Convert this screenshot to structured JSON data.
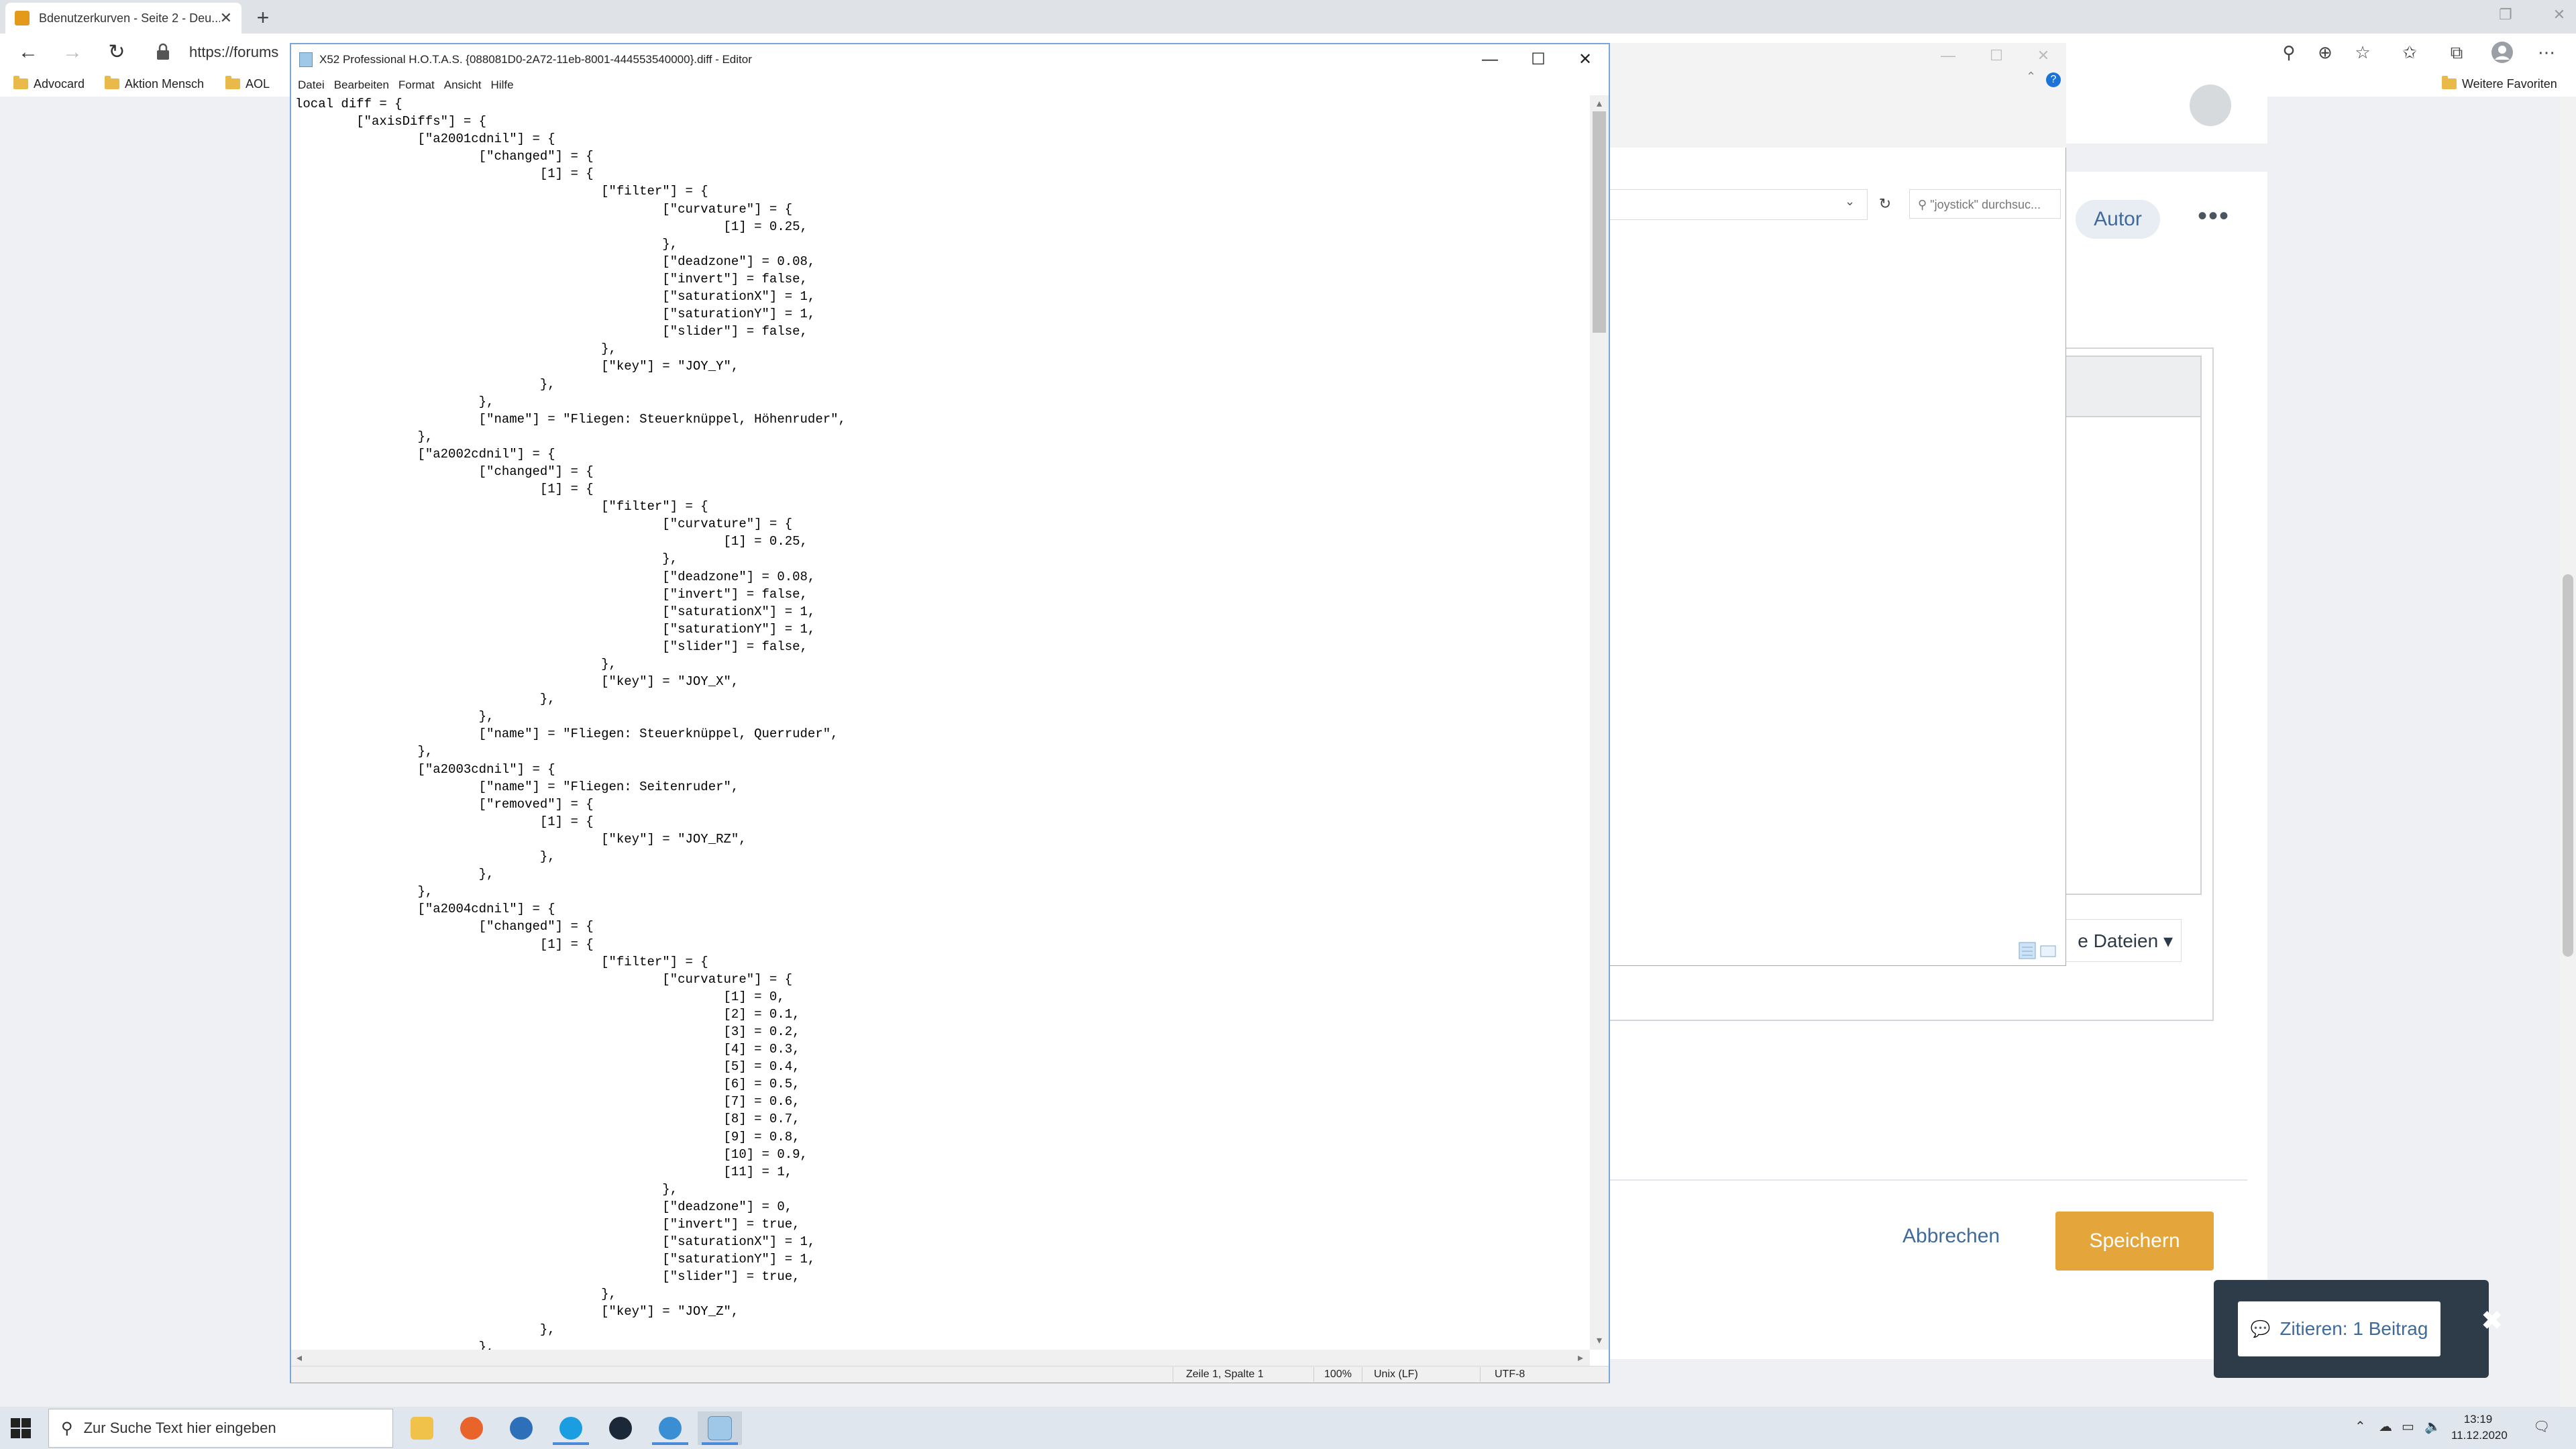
{
  "browser": {
    "tab_title": "Bdenutzerkurven - Seite 2 - Deu...",
    "tab_close": "✕",
    "new_tab": "+",
    "address": "https://forums",
    "bookmarks": [
      {
        "label": "Advocard"
      },
      {
        "label": "Aktion Mensch"
      },
      {
        "label": "AOL"
      }
    ],
    "bookmarks_right": "Weitere Favoriten"
  },
  "webpage": {
    "autor_label": "Autor",
    "more_label": "•••",
    "dateien_label": "e Dateien ▾",
    "abbrechen_label": "Abbrechen",
    "speichern_label": "Speichern",
    "quote_label": "Zitieren: 1 Beitrag",
    "quote_close": "✖"
  },
  "explorer": {
    "search_placeholder": "\"joystick\" durchsuc...",
    "help": "?"
  },
  "notepad": {
    "title": "X52 Professional H.O.T.A.S. {088081D0-2A72-11eb-8001-444553540000}.diff - Editor",
    "menu": [
      "Datei",
      "Bearbeiten",
      "Format",
      "Ansicht",
      "Hilfe"
    ],
    "content": "local diff = {\n\t[\"axisDiffs\"] = {\n\t\t[\"a2001cdnil\"] = {\n\t\t\t[\"changed\"] = {\n\t\t\t\t[1] = {\n\t\t\t\t\t[\"filter\"] = {\n\t\t\t\t\t\t[\"curvature\"] = {\n\t\t\t\t\t\t\t[1] = 0.25,\n\t\t\t\t\t\t},\n\t\t\t\t\t\t[\"deadzone\"] = 0.08,\n\t\t\t\t\t\t[\"invert\"] = false,\n\t\t\t\t\t\t[\"saturationX\"] = 1,\n\t\t\t\t\t\t[\"saturationY\"] = 1,\n\t\t\t\t\t\t[\"slider\"] = false,\n\t\t\t\t\t},\n\t\t\t\t\t[\"key\"] = \"JOY_Y\",\n\t\t\t\t},\n\t\t\t},\n\t\t\t[\"name\"] = \"Fliegen: Steuerknüppel, Höhenruder\",\n\t\t},\n\t\t[\"a2002cdnil\"] = {\n\t\t\t[\"changed\"] = {\n\t\t\t\t[1] = {\n\t\t\t\t\t[\"filter\"] = {\n\t\t\t\t\t\t[\"curvature\"] = {\n\t\t\t\t\t\t\t[1] = 0.25,\n\t\t\t\t\t\t},\n\t\t\t\t\t\t[\"deadzone\"] = 0.08,\n\t\t\t\t\t\t[\"invert\"] = false,\n\t\t\t\t\t\t[\"saturationX\"] = 1,\n\t\t\t\t\t\t[\"saturationY\"] = 1,\n\t\t\t\t\t\t[\"slider\"] = false,\n\t\t\t\t\t},\n\t\t\t\t\t[\"key\"] = \"JOY_X\",\n\t\t\t\t},\n\t\t\t},\n\t\t\t[\"name\"] = \"Fliegen: Steuerknüppel, Querruder\",\n\t\t},\n\t\t[\"a2003cdnil\"] = {\n\t\t\t[\"name\"] = \"Fliegen: Seitenruder\",\n\t\t\t[\"removed\"] = {\n\t\t\t\t[1] = {\n\t\t\t\t\t[\"key\"] = \"JOY_RZ\",\n\t\t\t\t},\n\t\t\t},\n\t\t},\n\t\t[\"a2004cdnil\"] = {\n\t\t\t[\"changed\"] = {\n\t\t\t\t[1] = {\n\t\t\t\t\t[\"filter\"] = {\n\t\t\t\t\t\t[\"curvature\"] = {\n\t\t\t\t\t\t\t[1] = 0,\n\t\t\t\t\t\t\t[2] = 0.1,\n\t\t\t\t\t\t\t[3] = 0.2,\n\t\t\t\t\t\t\t[4] = 0.3,\n\t\t\t\t\t\t\t[5] = 0.4,\n\t\t\t\t\t\t\t[6] = 0.5,\n\t\t\t\t\t\t\t[7] = 0.6,\n\t\t\t\t\t\t\t[8] = 0.7,\n\t\t\t\t\t\t\t[9] = 0.8,\n\t\t\t\t\t\t\t[10] = 0.9,\n\t\t\t\t\t\t\t[11] = 1,\n\t\t\t\t\t\t},\n\t\t\t\t\t\t[\"deadzone\"] = 0,\n\t\t\t\t\t\t[\"invert\"] = true,\n\t\t\t\t\t\t[\"saturationX\"] = 1,\n\t\t\t\t\t\t[\"saturationY\"] = 1,\n\t\t\t\t\t\t[\"slider\"] = true,\n\t\t\t\t\t},\n\t\t\t\t\t[\"key\"] = \"JOY_Z\",\n\t\t\t\t},\n\t\t\t},",
    "status": {
      "position": "Zeile 1, Spalte 1",
      "zoom": "100%",
      "line_ending": "Unix (LF)",
      "encoding": "UTF-8"
    }
  },
  "taskbar": {
    "search_placeholder": "Zur Suche Text hier eingeben",
    "time": "13:19",
    "date": "11.12.2020"
  },
  "colors": {
    "accent_orange": "#e4a53b",
    "link_blue": "#3e6b9c",
    "quote_panel": "#2e3c4a"
  }
}
